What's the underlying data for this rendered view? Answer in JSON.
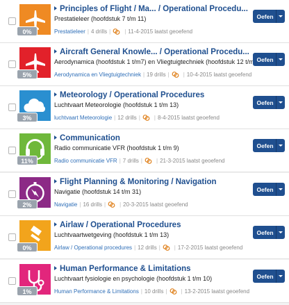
{
  "drills_suffix": "drills",
  "button_label": "Oefen",
  "last_practiced_suffix": "laatst geoefend",
  "rows": [
    {
      "color": "#ef8a23",
      "icon": "plane-icon",
      "percent": "0%",
      "title": "Principles of Flight / Ma... / Operational Procedu...",
      "subtitle": "Prestatieleer (hoofdstuk 7 t/m 11)",
      "category": "Prestatieleer",
      "drills": "4 drills",
      "date": "11-4-2015"
    },
    {
      "color": "#e2212a",
      "icon": "plane-icon",
      "percent": "5%",
      "title": "Aircraft General Knowle... / Operational Procedu...",
      "subtitle": "Aerodynamica (hoofdstuk 1 t/m7) en Vliegtuigtechniek (hoofdstuk 12 t/m 18)",
      "category": "Aerodynamica en Vliegtuigtechniek",
      "drills": "19 drills",
      "date": "10-4-2015"
    },
    {
      "color": "#2a8fd0",
      "icon": "cloud-icon",
      "percent": "3%",
      "title": "Meteorology / Operational Procedures",
      "subtitle": "Luchtvaart Meteorologie (hoofdstuk 1 t/m 13)",
      "category": "luchtvaart Meteorologie",
      "drills": "12 drills",
      "date": "8-4-2015"
    },
    {
      "color": "#6fb83b",
      "icon": "headset-icon",
      "percent": "11%",
      "title": "Communication",
      "subtitle": "Radio communicatie VFR (hoofdstuk 1 t/m 9)",
      "category": "Radio communicatie VFR",
      "drills": "7 drills",
      "date": "21-3-2015"
    },
    {
      "color": "#8c2a86",
      "icon": "compass-icon",
      "percent": "2%",
      "title": "Flight Planning & Monitoring / Navigation",
      "subtitle": "Navigatie (hoofdstuk 14 t/m 31)",
      "category": "Navigatie",
      "drills": "16 drills",
      "date": "20-3-2015"
    },
    {
      "color": "#f2a41c",
      "icon": "gavel-icon",
      "percent": "0%",
      "title": "Airlaw / Operational Procedures",
      "subtitle": "Luchtvaartwetgeving (hoofdstuk 1 t/m 13)",
      "category": "Airlaw / Operational procedures",
      "drills": "12 drills",
      "date": "17-2-2015"
    },
    {
      "color": "#e2267c",
      "icon": "stethoscope-icon",
      "percent": "1%",
      "title": "Human Performance & Limitations",
      "subtitle": "Luchtvaart fysiologie en psychologie (hoofdstuk 1 t/m 10)",
      "category": "Human Performance & Limitations",
      "drills": "10 drills",
      "date": "13-2-2015"
    }
  ]
}
